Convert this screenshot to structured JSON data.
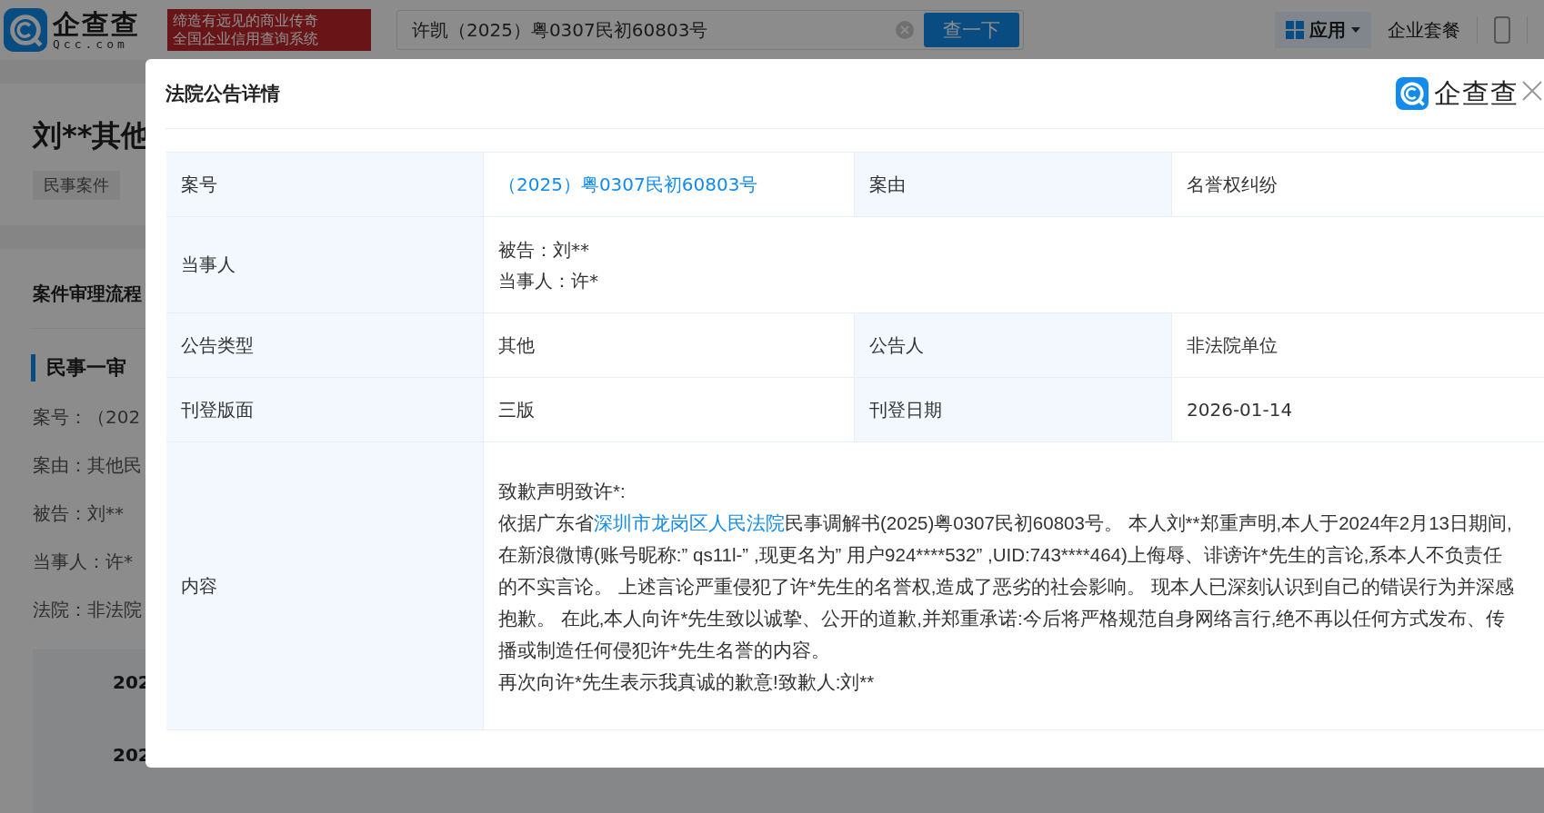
{
  "header": {
    "logo_text": "企查查",
    "logo_domain": "Qcc.com",
    "slogan_lines": [
      "缔造有远见的商业传奇",
      "全国企业信用查询系统"
    ],
    "search": {
      "value": "许凯（2025）粤0307民初60803号"
    },
    "search_button": "查一下",
    "apps_button": "应用",
    "plan_link": "企业套餐"
  },
  "background": {
    "case_title": "刘**其他",
    "tags": [
      {
        "label": "民事案件"
      }
    ],
    "section_title": "案件审理流程",
    "stage_title": "民事一审",
    "fields": [
      "案号：（202",
      "案由：其他民",
      "被告：刘**",
      "当事人：许*",
      "法院：非法院"
    ],
    "timeline": [
      "202",
      "202"
    ]
  },
  "modal": {
    "title": "法院公告详情",
    "brand": "企查查",
    "rows": [
      {
        "cells": [
          {
            "kind": "label",
            "text": "案号"
          },
          {
            "kind": "link",
            "text": "（2025）粤0307民初60803号"
          },
          {
            "kind": "label",
            "text": "案由"
          },
          {
            "kind": "value",
            "text": "名誉权纠纷"
          }
        ]
      },
      {
        "cells": [
          {
            "kind": "label",
            "text": "当事人"
          },
          {
            "kind": "lines",
            "lines": [
              "被告：刘**",
              "当事人：许*"
            ]
          }
        ]
      },
      {
        "cells": [
          {
            "kind": "label",
            "text": "公告类型"
          },
          {
            "kind": "value",
            "text": "其他"
          },
          {
            "kind": "label",
            "text": "公告人"
          },
          {
            "kind": "value",
            "text": "非法院单位"
          }
        ]
      },
      {
        "cells": [
          {
            "kind": "label",
            "text": "刊登版面"
          },
          {
            "kind": "value",
            "text": "三版"
          },
          {
            "kind": "label",
            "text": "刊登日期"
          },
          {
            "kind": "value",
            "text": "2026-01-14"
          }
        ]
      },
      {
        "cells": [
          {
            "kind": "label",
            "text": "内容"
          },
          {
            "kind": "content",
            "greeting": "致歉声明致许*:",
            "body_before": "依据广东省",
            "body_link": "深圳市龙岗区人民法院",
            "body_after": "民事调解书(2025)粤0307民初60803号。 本人刘**郑重声明,本人于2024年2月13日期间,在新浪微博(账号昵称:” qs11l-” ,现更名为” 用户924****532” ,UID:743****464)上侮辱、诽谤许*先生的言论,系本人不负责任的不实言论。 上述言论严重侵犯了许*先生的名誉权,造成了恶劣的社会影响。 现本人已深刻认识到自己的错误行为并深感抱歉。 在此,本人向许*先生致以诚挚、公开的道歉,并郑重承诺:今后将严格规范自身网络言行,绝不再以任何方式发布、传播或制造任何侵犯许*先生名誉的内容。",
            "closing": "再次向许*先生表示我真诚的歉意!致歉人:刘**"
          }
        ]
      }
    ]
  }
}
